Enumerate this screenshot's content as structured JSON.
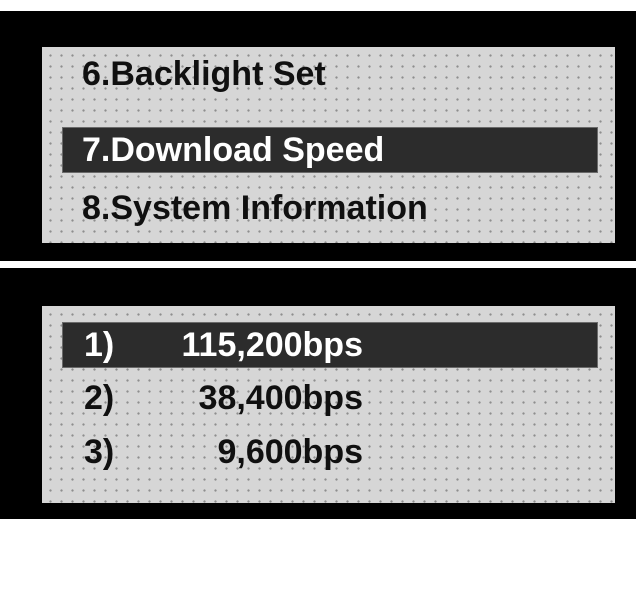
{
  "menu": {
    "items": [
      {
        "label": "6.Backlight Set",
        "selected": false
      },
      {
        "label": "7.Download Speed",
        "selected": true
      },
      {
        "label": "8.System Information",
        "selected": false
      }
    ]
  },
  "speed_options": {
    "items": [
      {
        "number": "1)",
        "value": "115,200bps",
        "selected": true
      },
      {
        "number": "2)",
        "value": "38,400bps",
        "selected": false
      },
      {
        "number": "3)",
        "value": "9,600bps",
        "selected": false
      }
    ]
  },
  "colors": {
    "bezel": "#000000",
    "lcd_background": "#d6d6d6",
    "highlight": "#2c2c2c",
    "text": "#101010",
    "highlight_text": "#ffffff"
  }
}
